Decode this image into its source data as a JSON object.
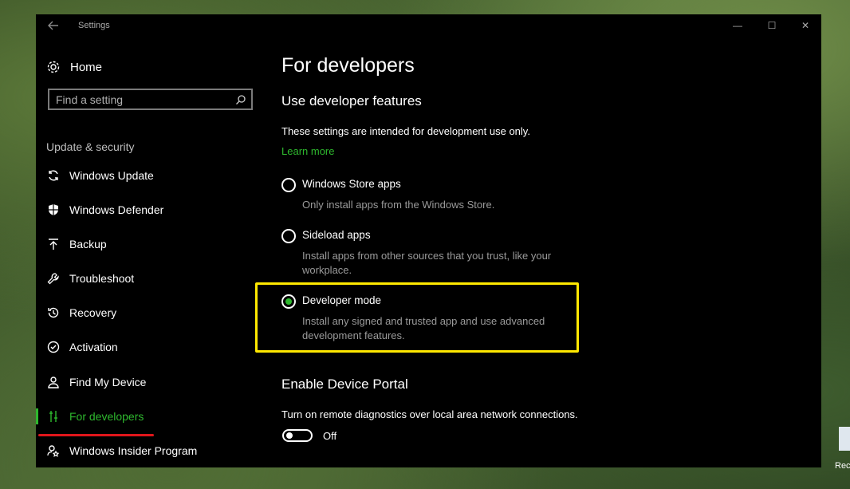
{
  "window": {
    "title": "Settings",
    "controls": {
      "minimize": "—",
      "maximize": "☐",
      "close": "✕"
    }
  },
  "sidebar": {
    "home_label": "Home",
    "search_placeholder": "Find a setting",
    "group_label": "Update & security",
    "items": [
      {
        "label": "Windows Update",
        "icon": "sync-icon"
      },
      {
        "label": "Windows Defender",
        "icon": "shield-icon"
      },
      {
        "label": "Backup",
        "icon": "upload-arrow-icon"
      },
      {
        "label": "Troubleshoot",
        "icon": "wrench-icon"
      },
      {
        "label": "Recovery",
        "icon": "history-icon"
      },
      {
        "label": "Activation",
        "icon": "check-circle-icon"
      },
      {
        "label": "Find My Device",
        "icon": "person-pin-icon"
      },
      {
        "label": "For developers",
        "icon": "developer-tools-icon",
        "active": true
      },
      {
        "label": "Windows Insider Program",
        "icon": "insider-person-icon"
      }
    ]
  },
  "main": {
    "page_title": "For developers",
    "section1_title": "Use developer features",
    "section1_desc": "These settings are intended for development use only.",
    "learn_more": "Learn more",
    "options": [
      {
        "label": "Windows Store apps",
        "desc": "Only install apps from the Windows Store.",
        "selected": false
      },
      {
        "label": "Sideload apps",
        "desc": "Install apps from other sources that you trust, like your workplace.",
        "selected": false
      },
      {
        "label": "Developer mode",
        "desc": "Install any signed and trusted app and use advanced development features.",
        "selected": true
      }
    ],
    "section2_title": "Enable Device Portal",
    "section2_desc": "Turn on remote diagnostics over local area network connections.",
    "toggle_state": "Off"
  },
  "desktop": {
    "icon_label": "Recy"
  },
  "colors": {
    "accent": "#2eb82e",
    "highlight": "#ffe800",
    "underline": "#e0161b",
    "window_bg": "#000000"
  }
}
